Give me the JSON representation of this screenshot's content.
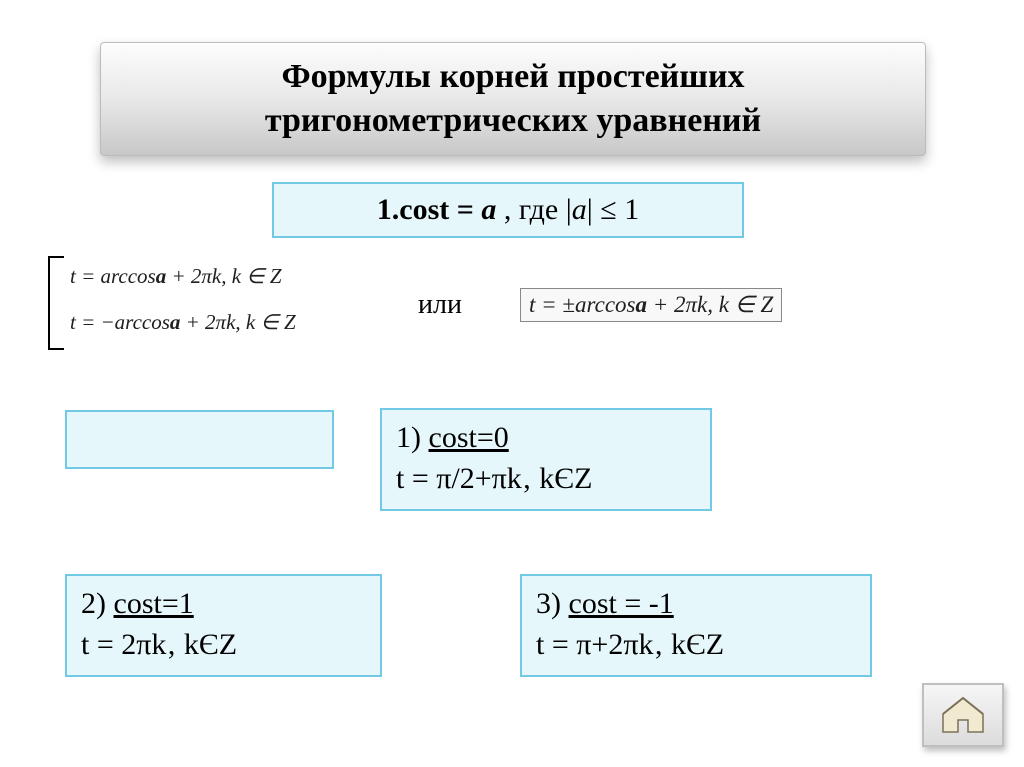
{
  "title": {
    "line1": "Формулы корней простейших",
    "line2": "тригонометрических уравнений"
  },
  "main_eq": {
    "prefix": "1.cost = ",
    "a": "а",
    "mid": " ,  где |",
    "a2": "а",
    "suffix": "| ≤ 1"
  },
  "bracket": {
    "line1_pre": "t = arccos",
    "line1_a": "a",
    "line1_post": " + 2πk, k ∈ Z",
    "line2_pre": "t = −arccos",
    "line2_a": "a",
    "line2_post": " + 2πk, k ∈ Z"
  },
  "ili": "или",
  "right_formula": {
    "pre": "t = ±arccos",
    "a": "a",
    "post": " + 2πk, k ∈ Z"
  },
  "case1": {
    "head_num": "1)   ",
    "head_eq": "cost=0",
    "line2": "t = π/2+πk‚ kЄZ"
  },
  "case2": {
    "head_num": "2)    ",
    "head_eq": "cost=1",
    "line2": "       t = 2πk‚ kЄZ"
  },
  "case3": {
    "head_num": "3)    ",
    "head_eq": "cost = -1",
    "line2": "       t = π+2πk‚ kЄZ"
  },
  "icons": {
    "home": "home-icon"
  }
}
